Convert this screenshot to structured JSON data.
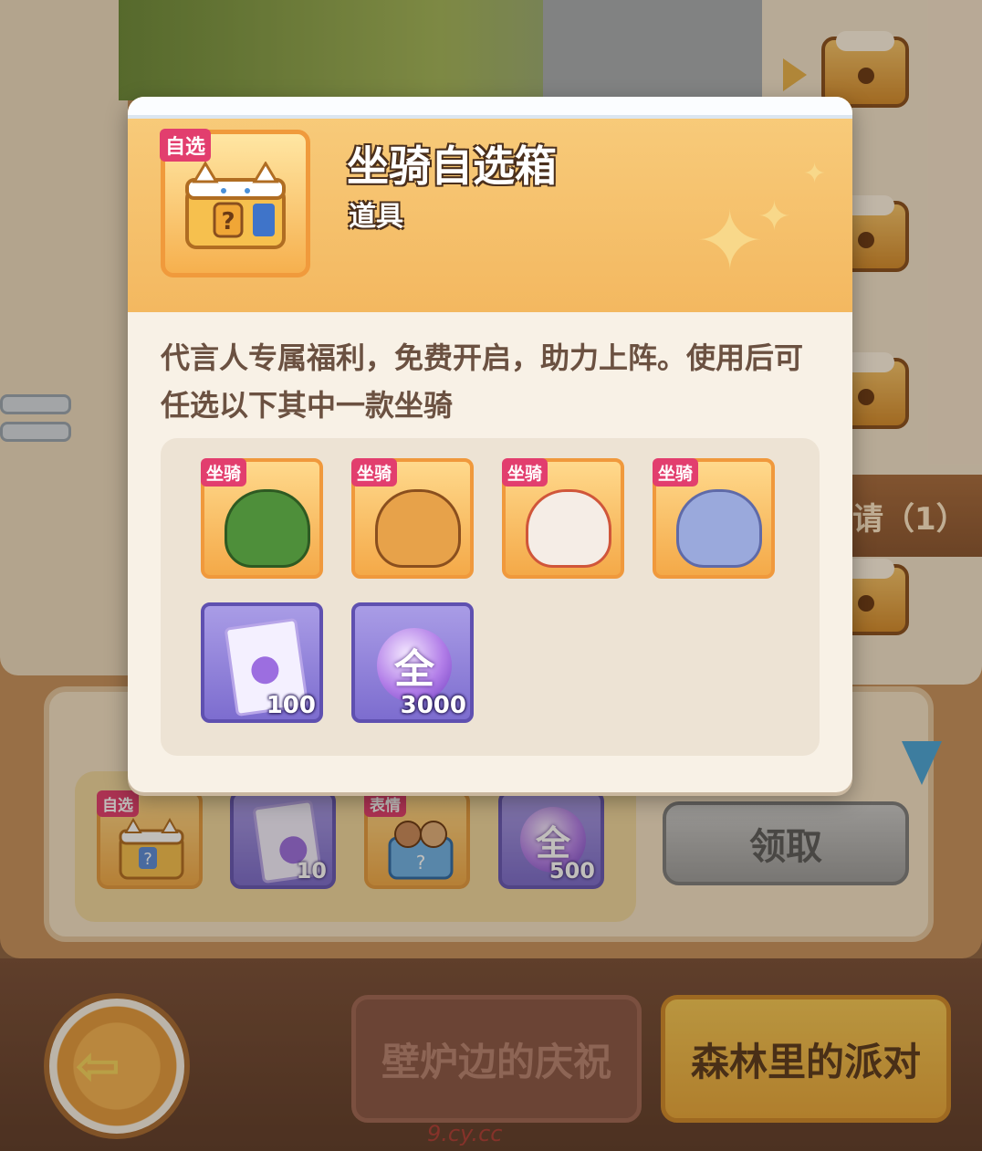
{
  "modal": {
    "title": "坐骑自选箱",
    "type": "道具",
    "icon_tag": "自选",
    "description": "代言人专属福利，免费开启，助力上阵。使用后可任选以下其中一款坐骑",
    "options": [
      {
        "tag": "坐骑",
        "icon": "green-bush-mount-icon",
        "count": ""
      },
      {
        "tag": "坐骑",
        "icon": "eagle-aviator-mount-icon",
        "count": ""
      },
      {
        "tag": "坐骑",
        "icon": "lion-dance-mount-icon",
        "count": ""
      },
      {
        "tag": "坐骑",
        "icon": "star-elephant-mount-icon",
        "count": ""
      },
      {
        "tag": "",
        "icon": "integral-ticket-icon",
        "count": "100"
      },
      {
        "tag": "",
        "icon": "all-orb-icon",
        "count": "3000",
        "orb_label": "全"
      }
    ]
  },
  "background": {
    "invite_label": "请（1）",
    "reward_items": [
      {
        "tag": "自选",
        "icon": "cat-chest-icon",
        "count": ""
      },
      {
        "tag": "",
        "icon": "integral-ticket-icon",
        "count": "10"
      },
      {
        "tag": "表情",
        "icon": "emote-pack-icon",
        "count": ""
      },
      {
        "tag": "",
        "icon": "all-orb-icon",
        "count": "500",
        "orb_label": "全"
      }
    ],
    "claim_button": "领取",
    "tabs": [
      {
        "label": "壁炉边的庆祝",
        "active": false
      },
      {
        "label": "森林里的派对",
        "active": true
      }
    ],
    "watermark": "9.cy.cc"
  },
  "colors": {
    "accent_gold": "#f4a948",
    "tag_pink": "#e23e6e",
    "purple_item": "#7d6dcf"
  }
}
